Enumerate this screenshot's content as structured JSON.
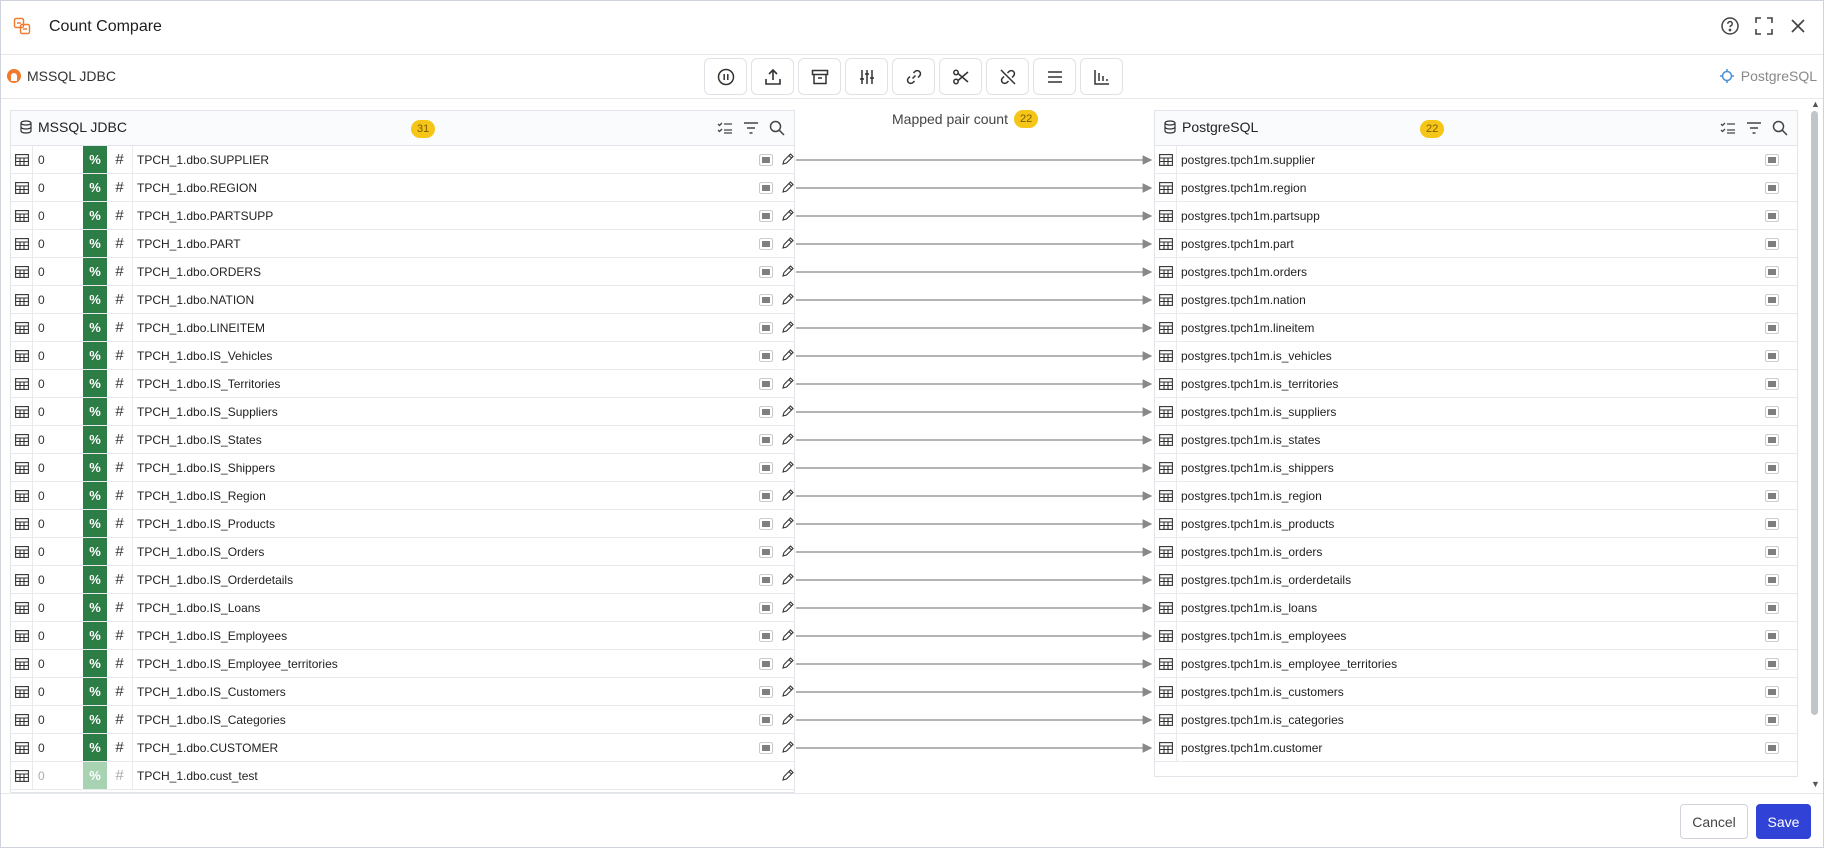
{
  "window": {
    "title": "Count Compare"
  },
  "source": {
    "name": "MSSQL JDBC",
    "count": "31"
  },
  "target": {
    "name": "PostgreSQL",
    "count": "22"
  },
  "mapping": {
    "label": "Mapped pair count",
    "count": "22"
  },
  "toolbar": {
    "tools": [
      "pause-icon",
      "upload-icon",
      "archive-icon",
      "sliders-icon",
      "link-icon",
      "scissors-icon",
      "unlink-icon",
      "menu-icon",
      "bar-chart-icon"
    ]
  },
  "left_rows": [
    {
      "count": "0",
      "pct": "%",
      "hash": "#",
      "name": "TPCH_1.dbo.SUPPLIER"
    },
    {
      "count": "0",
      "pct": "%",
      "hash": "#",
      "name": "TPCH_1.dbo.REGION"
    },
    {
      "count": "0",
      "pct": "%",
      "hash": "#",
      "name": "TPCH_1.dbo.PARTSUPP"
    },
    {
      "count": "0",
      "pct": "%",
      "hash": "#",
      "name": "TPCH_1.dbo.PART"
    },
    {
      "count": "0",
      "pct": "%",
      "hash": "#",
      "name": "TPCH_1.dbo.ORDERS"
    },
    {
      "count": "0",
      "pct": "%",
      "hash": "#",
      "name": "TPCH_1.dbo.NATION"
    },
    {
      "count": "0",
      "pct": "%",
      "hash": "#",
      "name": "TPCH_1.dbo.LINEITEM"
    },
    {
      "count": "0",
      "pct": "%",
      "hash": "#",
      "name": "TPCH_1.dbo.IS_Vehicles"
    },
    {
      "count": "0",
      "pct": "%",
      "hash": "#",
      "name": "TPCH_1.dbo.IS_Territories"
    },
    {
      "count": "0",
      "pct": "%",
      "hash": "#",
      "name": "TPCH_1.dbo.IS_Suppliers"
    },
    {
      "count": "0",
      "pct": "%",
      "hash": "#",
      "name": "TPCH_1.dbo.IS_States"
    },
    {
      "count": "0",
      "pct": "%",
      "hash": "#",
      "name": "TPCH_1.dbo.IS_Shippers"
    },
    {
      "count": "0",
      "pct": "%",
      "hash": "#",
      "name": "TPCH_1.dbo.IS_Region"
    },
    {
      "count": "0",
      "pct": "%",
      "hash": "#",
      "name": "TPCH_1.dbo.IS_Products"
    },
    {
      "count": "0",
      "pct": "%",
      "hash": "#",
      "name": "TPCH_1.dbo.IS_Orders"
    },
    {
      "count": "0",
      "pct": "%",
      "hash": "#",
      "name": "TPCH_1.dbo.IS_Orderdetails"
    },
    {
      "count": "0",
      "pct": "%",
      "hash": "#",
      "name": "TPCH_1.dbo.IS_Loans"
    },
    {
      "count": "0",
      "pct": "%",
      "hash": "#",
      "name": "TPCH_1.dbo.IS_Employees"
    },
    {
      "count": "0",
      "pct": "%",
      "hash": "#",
      "name": "TPCH_1.dbo.IS_Employee_territories"
    },
    {
      "count": "0",
      "pct": "%",
      "hash": "#",
      "name": "TPCH_1.dbo.IS_Customers"
    },
    {
      "count": "0",
      "pct": "%",
      "hash": "#",
      "name": "TPCH_1.dbo.IS_Categories"
    },
    {
      "count": "0",
      "pct": "%",
      "hash": "#",
      "name": "TPCH_1.dbo.CUSTOMER"
    },
    {
      "count": "0",
      "pct": "%",
      "hash": "#",
      "name": "TPCH_1.dbo.cust_test",
      "disabled": true
    }
  ],
  "right_rows": [
    "postgres.tpch1m.supplier",
    "postgres.tpch1m.region",
    "postgres.tpch1m.partsupp",
    "postgres.tpch1m.part",
    "postgres.tpch1m.orders",
    "postgres.tpch1m.nation",
    "postgres.tpch1m.lineitem",
    "postgres.tpch1m.is_vehicles",
    "postgres.tpch1m.is_territories",
    "postgres.tpch1m.is_suppliers",
    "postgres.tpch1m.is_states",
    "postgres.tpch1m.is_shippers",
    "postgres.tpch1m.is_region",
    "postgres.tpch1m.is_products",
    "postgres.tpch1m.is_orders",
    "postgres.tpch1m.is_orderdetails",
    "postgres.tpch1m.is_loans",
    "postgres.tpch1m.is_employees",
    "postgres.tpch1m.is_employee_territories",
    "postgres.tpch1m.is_customers",
    "postgres.tpch1m.is_categories",
    "postgres.tpch1m.customer"
  ],
  "footer": {
    "cancel_label": "Cancel",
    "save_label": "Save"
  },
  "colors": {
    "accent": "#3143d6",
    "match": "#2d7d46",
    "badge": "#f5c518",
    "brand": "#f07a2e"
  }
}
